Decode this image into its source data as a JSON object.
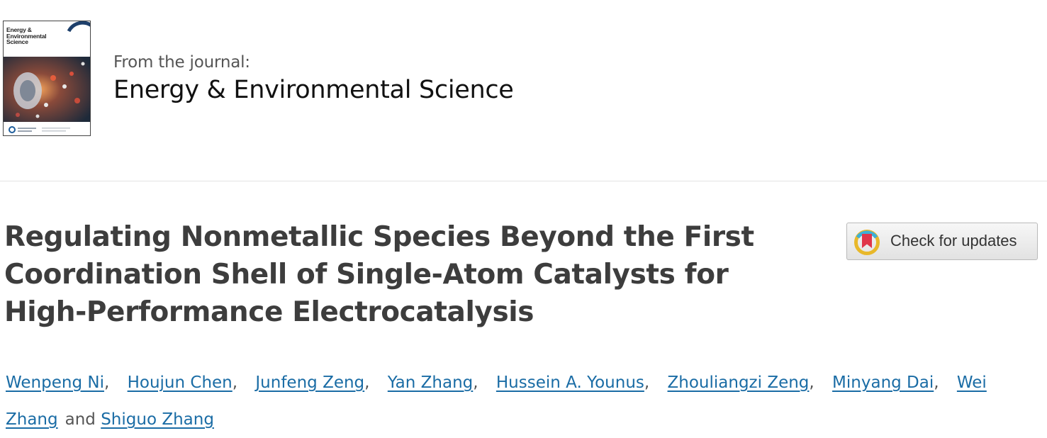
{
  "journal": {
    "from_label": "From the journal:",
    "name": "Energy & Environmental Science",
    "cover_title": "Energy &\nEnvironmental\nScience"
  },
  "article": {
    "title": "Regulating Nonmetallic Species Beyond the First Coordination Shell of Single-Atom Catalysts for High-Performance Electrocatalysis"
  },
  "check_updates": {
    "label": "Check for updates",
    "icon": "crossmark-icon"
  },
  "authors": {
    "names": [
      "Wenpeng Ni",
      "Houjun Chen",
      "Junfeng Zeng",
      "Yan Zhang",
      "Hussein A. Younus",
      "Zhouliangzi Zeng",
      "Minyang Dai",
      "Wei Zhang",
      "Shiguo Zhang"
    ],
    "separator": ",",
    "conjunction": "and"
  },
  "colors": {
    "link": "#1a6ca5",
    "title": "#3d3d3d"
  }
}
